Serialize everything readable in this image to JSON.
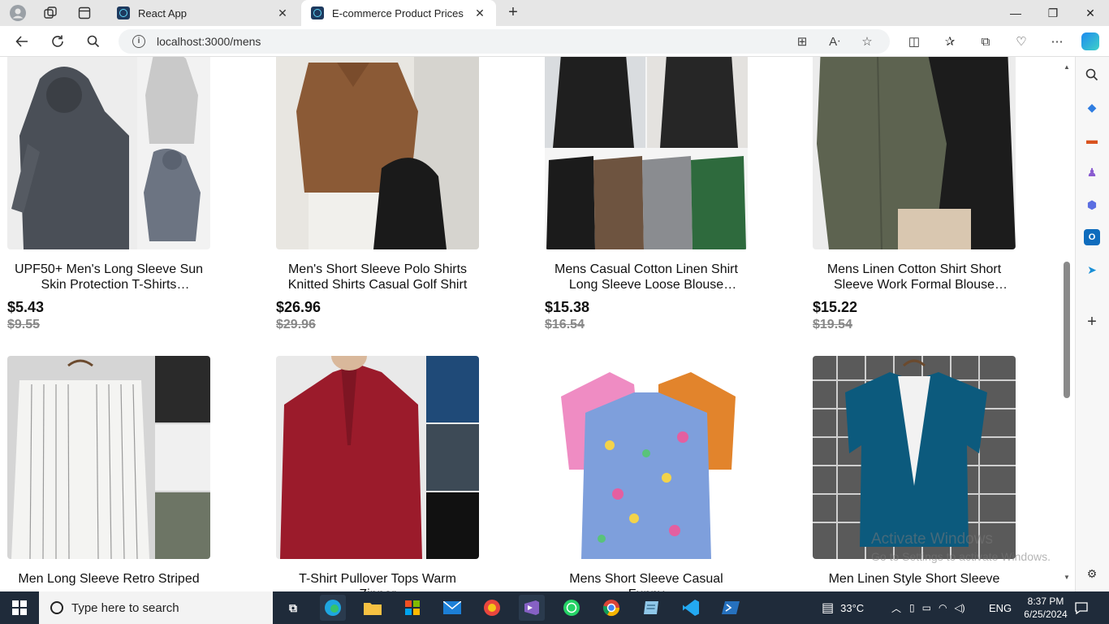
{
  "browser": {
    "tabs": [
      {
        "title": "React App",
        "active": false
      },
      {
        "title": "E-commerce Product Prices",
        "active": true
      }
    ],
    "url": "localhost:3000/mens"
  },
  "products": [
    {
      "name": "UPF50+ Men's Long Sleeve Sun Skin Protection T-Shirts Outdoor...",
      "price": "$5.43",
      "old_price": "$9.55"
    },
    {
      "name": "Men's Short Sleeve Polo Shirts Knitted Shirts Casual Golf Shirt",
      "price": "$26.96",
      "old_price": "$29.96"
    },
    {
      "name": "Mens Casual Cotton Linen Shirt Long Sleeve Loose Blouse Button...",
      "price": "$15.38",
      "old_price": "$16.54"
    },
    {
      "name": "Mens Linen Cotton Shirt Short Sleeve Work Formal Blouse Butto...",
      "price": "$15.22",
      "old_price": "$19.54"
    },
    {
      "name": "Men Long Sleeve Retro Striped"
    },
    {
      "name": "T-Shirt Pullover Tops Warm Zipper"
    },
    {
      "name": "Mens Short Sleeve Casual Funny"
    },
    {
      "name": "Men Linen Style Short Sleeve"
    }
  ],
  "watermark": {
    "line1": "Activate Windows",
    "line2": "Go to Settings to activate Windows."
  },
  "taskbar": {
    "search_placeholder": "Type here to search",
    "temperature": "33°C",
    "language": "ENG",
    "time": "8:37 PM",
    "date": "6/25/2024"
  }
}
